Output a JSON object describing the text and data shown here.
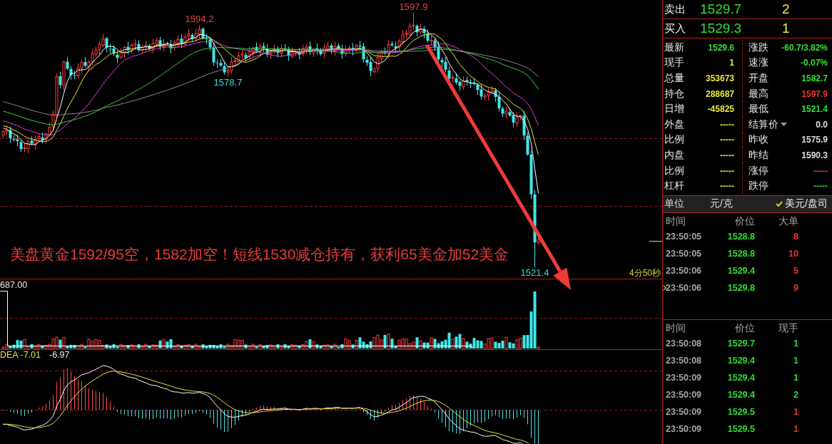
{
  "price_chart": {
    "marks": [
      {
        "text": "1597.9",
        "kind": "high"
      },
      {
        "text": "1594.2",
        "kind": "high"
      },
      {
        "text": "1578.7",
        "kind": "low"
      },
      {
        "text": "1521.4",
        "kind": "low"
      }
    ],
    "note": "美盘黄金1592/95空，1582加空！短线1530减仓持有，获利65美金加52美金",
    "countdown": "4分50秒"
  },
  "volume_chart": {
    "scale_label": "687.00"
  },
  "macd_chart": {
    "dea_label": "DEA -7.01",
    "value_label": "-6.97"
  },
  "quote": {
    "book": [
      {
        "label": "卖出",
        "price": "1529.7",
        "volume": "2"
      },
      {
        "label": "买入",
        "price": "1529.3",
        "volume": "1"
      }
    ],
    "grid": [
      {
        "label": "最新",
        "value": "1529.6",
        "color": "#33dd33",
        "dropdown": false
      },
      {
        "label": "涨跌",
        "value": "-60.7/3.82%",
        "color": "#33dd33",
        "dropdown": false
      },
      {
        "label": "现手",
        "value": "1",
        "color": "#e8e83a",
        "dropdown": false
      },
      {
        "label": "速涨",
        "value": "-0.07%",
        "color": "#33dd33",
        "dropdown": false
      },
      {
        "label": "总量",
        "value": "353673",
        "color": "#e8e83a",
        "dropdown": false
      },
      {
        "label": "开盘",
        "value": "1582.7",
        "color": "#33dd33",
        "dropdown": false
      },
      {
        "label": "持仓",
        "value": "288687",
        "color": "#e8e83a",
        "dropdown": false
      },
      {
        "label": "最高",
        "value": "1597.9",
        "color": "#ee3333",
        "dropdown": false
      },
      {
        "label": "日增",
        "value": "-45825",
        "color": "#e8e83a",
        "dropdown": false
      },
      {
        "label": "最低",
        "value": "1521.4",
        "color": "#33dd33",
        "dropdown": false
      },
      {
        "label": "外盘",
        "value": "-----",
        "color": "#e8e83a",
        "dropdown": false
      },
      {
        "label": "结算价",
        "value": "0.0",
        "color": "#dddddd",
        "dropdown": true
      },
      {
        "label": "比例",
        "value": "-----",
        "color": "#e8e83a",
        "dropdown": false
      },
      {
        "label": "昨收",
        "value": "1575.9",
        "color": "#dddddd",
        "dropdown": false
      },
      {
        "label": "内盘",
        "value": "-----",
        "color": "#e8e83a",
        "dropdown": false
      },
      {
        "label": "昨结",
        "value": "1590.3",
        "color": "#dddddd",
        "dropdown": false
      },
      {
        "label": "比例",
        "value": "-----",
        "color": "#e8e83a",
        "dropdown": false
      },
      {
        "label": "涨停",
        "value": "-----",
        "color": "#ee3333",
        "dropdown": false
      },
      {
        "label": "杠杆",
        "value": "-----",
        "color": "#e8e83a",
        "dropdown": false
      },
      {
        "label": "跌停",
        "value": "-----",
        "color": "#33dd33",
        "dropdown": false
      }
    ],
    "unit": {
      "label": "单位",
      "options": [
        {
          "label": "元/克",
          "selected": false
        },
        {
          "label": "美元/盘司",
          "selected": true
        }
      ]
    }
  },
  "big_orders": {
    "columns": [
      "时间",
      "价位",
      "大单"
    ],
    "rows": [
      {
        "time": "23:50:05",
        "price": "1528.8",
        "volume": "8",
        "color": "#ee3333",
        "selected": false
      },
      {
        "time": "23:50:05",
        "price": "1528.8",
        "volume": "10",
        "color": "#ee3333",
        "selected": false
      },
      {
        "time": "23:50:06",
        "price": "1529.4",
        "volume": "5",
        "color": "#ee3333",
        "selected": false
      },
      {
        "time": "23:50:06",
        "price": "1529.8",
        "volume": "9",
        "color": "#ee3333",
        "selected": true
      }
    ]
  },
  "ticks": {
    "columns": [
      "时间",
      "价位",
      "现手"
    ],
    "rows": [
      {
        "time": "23:50:08",
        "price": "1529.7",
        "volume": "1",
        "color": "#33dd33"
      },
      {
        "time": "23:50:08",
        "price": "1529.4",
        "volume": "1",
        "color": "#33dd33"
      },
      {
        "time": "23:50:09",
        "price": "1529.4",
        "volume": "1",
        "color": "#33dd33"
      },
      {
        "time": "23:50:09",
        "price": "1529.4",
        "volume": "2",
        "color": "#33dd33"
      },
      {
        "time": "23:50:09",
        "price": "1529.5",
        "volume": "1",
        "color": "#ee3333"
      },
      {
        "time": "23:50:09",
        "price": "1529.5",
        "volume": "1",
        "color": "#ee3333"
      }
    ]
  }
}
